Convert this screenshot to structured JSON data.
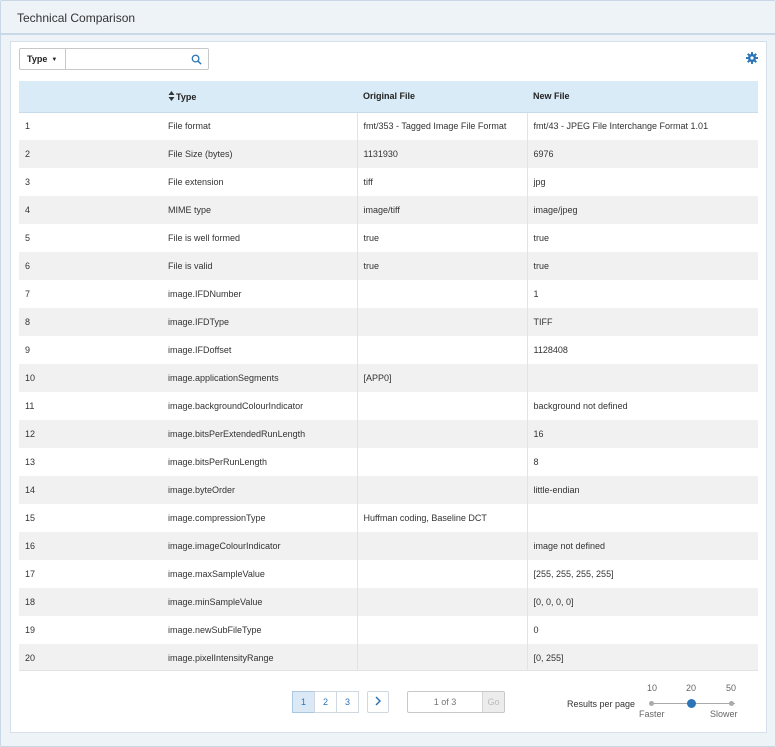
{
  "header": {
    "title": "Technical Comparison"
  },
  "toolbar": {
    "type_label": "Type",
    "search_value": ""
  },
  "table": {
    "columns": [
      "",
      "Type",
      "Original File",
      "New File"
    ],
    "rows": [
      [
        "1",
        "File format",
        "fmt/353 - Tagged Image File Format",
        "fmt/43 - JPEG File Interchange Format 1.01"
      ],
      [
        "2",
        "File Size (bytes)",
        "1131930",
        "6976"
      ],
      [
        "3",
        "File extension",
        "tiff",
        "jpg"
      ],
      [
        "4",
        "MIME type",
        "image/tiff",
        "image/jpeg"
      ],
      [
        "5",
        "File is well formed",
        "true",
        "true"
      ],
      [
        "6",
        "File is valid",
        "true",
        "true"
      ],
      [
        "7",
        "image.IFDNumber",
        "",
        "1"
      ],
      [
        "8",
        "image.IFDType",
        "",
        "TIFF"
      ],
      [
        "9",
        "image.IFDoffset",
        "",
        "1128408"
      ],
      [
        "10",
        "image.applicationSegments",
        "[APP0]",
        ""
      ],
      [
        "11",
        "image.backgroundColourIndicator",
        "",
        "background not defined"
      ],
      [
        "12",
        "image.bitsPerExtendedRunLength",
        "",
        "16"
      ],
      [
        "13",
        "image.bitsPerRunLength",
        "",
        "8"
      ],
      [
        "14",
        "image.byteOrder",
        "",
        "little-endian"
      ],
      [
        "15",
        "image.compressionType",
        "Huffman coding, Baseline DCT",
        ""
      ],
      [
        "16",
        "image.imageColourIndicator",
        "",
        "image not defined"
      ],
      [
        "17",
        "image.maxSampleValue",
        "",
        "[255, 255, 255, 255]"
      ],
      [
        "18",
        "image.minSampleValue",
        "",
        "[0, 0, 0, 0]"
      ],
      [
        "19",
        "image.newSubFileType",
        "",
        "0"
      ],
      [
        "20",
        "image.pixelIntensityRange",
        "",
        "[0, 255]"
      ]
    ]
  },
  "pagination": {
    "pages": [
      "1",
      "2",
      "3"
    ],
    "current_page": "1",
    "goto_placeholder": "1 of 3",
    "go_label": "Go"
  },
  "results_per_page": {
    "label": "Results per page",
    "options": [
      "10",
      "20",
      "50"
    ],
    "selected": "20",
    "faster_label": "Faster",
    "slower_label": "Slower"
  },
  "colors": {
    "accent": "#2b74b8",
    "header_bg": "#d9ebf7",
    "stripe": "#f1f1f1"
  }
}
